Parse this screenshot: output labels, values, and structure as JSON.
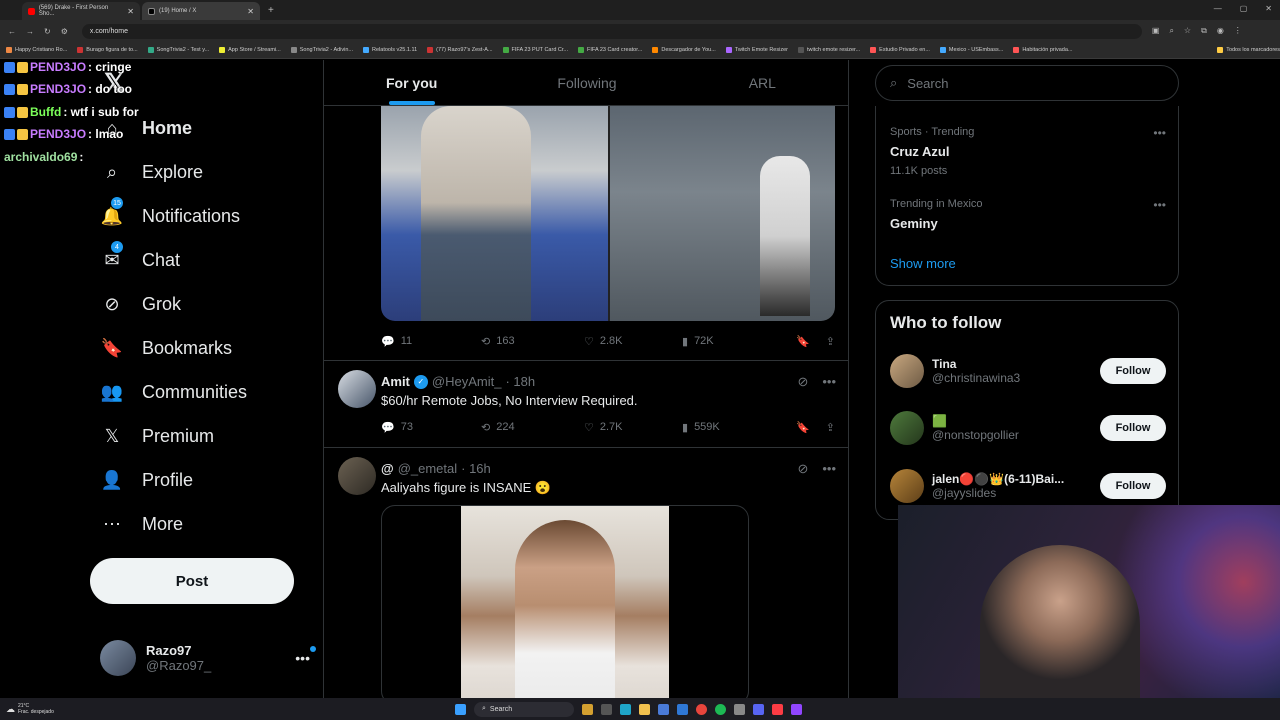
{
  "browser": {
    "tabs": [
      {
        "label": "(569) Drake - First Person Sho...",
        "fav": "#ff0000"
      },
      {
        "label": "(19) Home / X",
        "fav": "#000000"
      }
    ],
    "url": "x.com/home",
    "bookmarks": [
      "Happy Cristiano Ro...",
      "Burago figura de to...",
      "SongTrivia2 - Test y...",
      "App Store / Streami...",
      "SongTrivia2 - Adivin...",
      "Relatools v25.1.11",
      "(77) Razo97's Zest-A...",
      "FIFA 23 PUT Card Cr...",
      "FIFA 23 Card creator...",
      "Descargador de You...",
      "Twitch Emote Resizer",
      "twitch emote resizer...",
      "Estudio Privado en...",
      "Mexico - USEmbass...",
      "Habitación privada...",
      "Todos los marcadores"
    ]
  },
  "chat": [
    {
      "user": "PEND3JO",
      "msg": ": cringe",
      "color": "#c87cff"
    },
    {
      "user": "PEND3JO",
      "msg": ": do too",
      "color": "#c87cff"
    },
    {
      "user": "Buffd",
      "msg": ": wtf i sub for",
      "color": "#7cff5a"
    },
    {
      "user": "PEND3JO",
      "msg": ": lmao",
      "color": "#c87cff"
    },
    {
      "user": "archivaldo69",
      "msg": ":",
      "color": "#9fe0a0"
    }
  ],
  "nav": [
    {
      "label": "Home",
      "icon": "home-icon",
      "glyph": "⌂"
    },
    {
      "label": "Explore",
      "icon": "search-icon",
      "glyph": "⌕"
    },
    {
      "label": "Notifications",
      "icon": "bell-icon",
      "glyph": "🔔",
      "badge": "15"
    },
    {
      "label": "Chat",
      "icon": "mail-icon",
      "glyph": "✉",
      "badge": "4"
    },
    {
      "label": "Grok",
      "icon": "grok-icon",
      "glyph": "⊘"
    },
    {
      "label": "Bookmarks",
      "icon": "bookmark-icon",
      "glyph": "🔖"
    },
    {
      "label": "Communities",
      "icon": "communities-icon",
      "glyph": "👥"
    },
    {
      "label": "Premium",
      "icon": "x-logo-icon",
      "glyph": "𝕏"
    },
    {
      "label": "Profile",
      "icon": "person-icon",
      "glyph": "👤"
    },
    {
      "label": "More",
      "icon": "more-circle-icon",
      "glyph": "⋯"
    }
  ],
  "post_button": "Post",
  "account": {
    "name": "Razo97",
    "handle": "@Razo97_"
  },
  "feed_tabs": [
    "For you",
    "Following",
    "ARL"
  ],
  "post1_stats": {
    "replies": "11",
    "reposts": "163",
    "likes": "2.8K",
    "views": "72K"
  },
  "post2": {
    "name": "Amit",
    "handle": "@HeyAmit_",
    "time": "· 18h",
    "text": "$60/hr Remote Jobs, No Interview Required.",
    "replies": "73",
    "reposts": "224",
    "likes": "2.7K",
    "views": "559K"
  },
  "post3": {
    "name": "@",
    "handle": "@_emetal",
    "time": "· 16h",
    "text": "Aaliyahs figure is INSANE 😮"
  },
  "search_placeholder": "Search",
  "trends": [
    {
      "meta": "Sports · Trending",
      "title": "Cruz Azul",
      "count": "11.1K posts"
    },
    {
      "meta": "Trending in Mexico",
      "title": "Geminy",
      "count": ""
    }
  ],
  "show_more": "Show more",
  "who_to_follow": {
    "title": "Who to follow",
    "users": [
      {
        "name": "Tina",
        "handle": "@christinawina3"
      },
      {
        "name": "🟩",
        "handle": "@nonstopgollier"
      },
      {
        "name": "jalen🔴⚫👑(6-11)Bai...",
        "handle": "@jayyslides"
      }
    ],
    "follow_label": "Follow"
  },
  "taskbar": {
    "weather_temp": "21°C",
    "weather_desc": "Frac. despejado",
    "search": "Search"
  }
}
